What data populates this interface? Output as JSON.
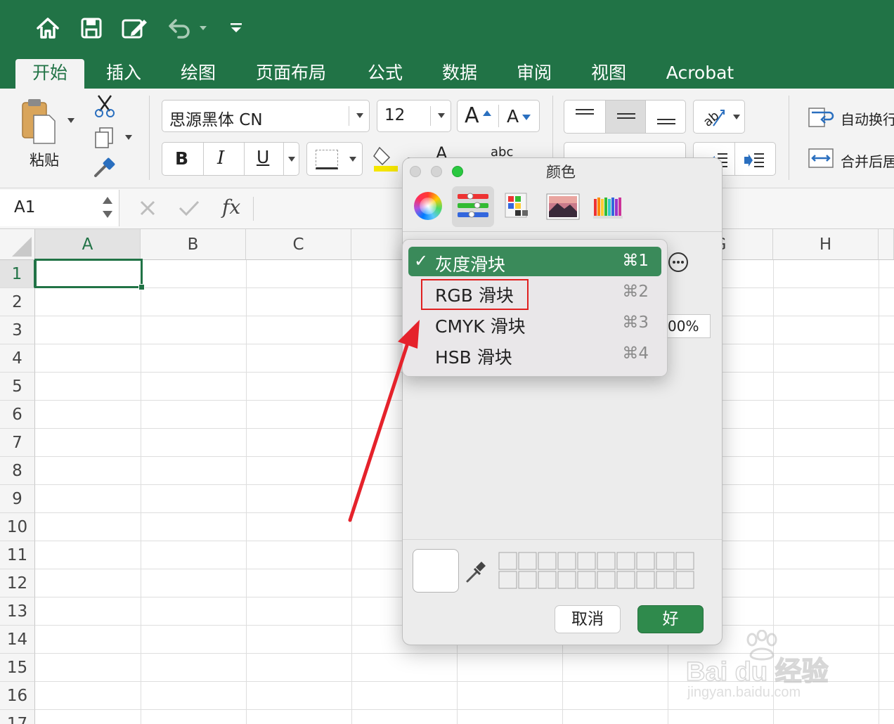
{
  "colors": {
    "excel_green": "#217346",
    "ok_button": "#2f8a4c",
    "menu_selected": "#3a8a5a",
    "highlight_box": "#e02020",
    "arrow": "#e5222b"
  },
  "qat": {
    "icons": [
      "home-icon",
      "save-icon",
      "edit-icon",
      "undo-icon",
      "chevron-down-icon",
      "customize-icon"
    ]
  },
  "tabs": [
    "开始",
    "插入",
    "绘图",
    "页面布局",
    "公式",
    "数据",
    "审阅",
    "视图",
    "Acrobat"
  ],
  "ribbon": {
    "paste_label": "粘贴",
    "font_name": "思源黑体 CN",
    "font_size": "12",
    "grow_font": "A",
    "shrink_font": "A",
    "bold": "B",
    "italic": "I",
    "underline": "U",
    "font_color_letter": "A",
    "abc_label": "abc",
    "wrap_text": "自动换行",
    "merge_center": "合并后居"
  },
  "formula_bar": {
    "name_box": "A1",
    "fx": "fx"
  },
  "grid": {
    "columns": [
      "A",
      "B",
      "C",
      "",
      "",
      "",
      "G",
      "H"
    ],
    "rows": [
      "1",
      "2",
      "3",
      "4",
      "5",
      "6",
      "7",
      "8",
      "9",
      "10",
      "11",
      "12",
      "13",
      "14",
      "15",
      "16",
      "17"
    ]
  },
  "color_panel": {
    "title": "颜色",
    "percent_value": "00%",
    "cancel": "取消",
    "ok": "好"
  },
  "menu": {
    "items": [
      {
        "label": "灰度滑块",
        "shortcut": "⌘1",
        "checked": true
      },
      {
        "label": "RGB 滑块",
        "shortcut": "⌘2",
        "checked": false
      },
      {
        "label": "CMYK 滑块",
        "shortcut": "⌘3",
        "checked": false
      },
      {
        "label": "HSB 滑块",
        "shortcut": "⌘4",
        "checked": false
      }
    ]
  },
  "watermark": {
    "brand": "Bai du 经验",
    "url": "jingyan.baidu.com"
  }
}
